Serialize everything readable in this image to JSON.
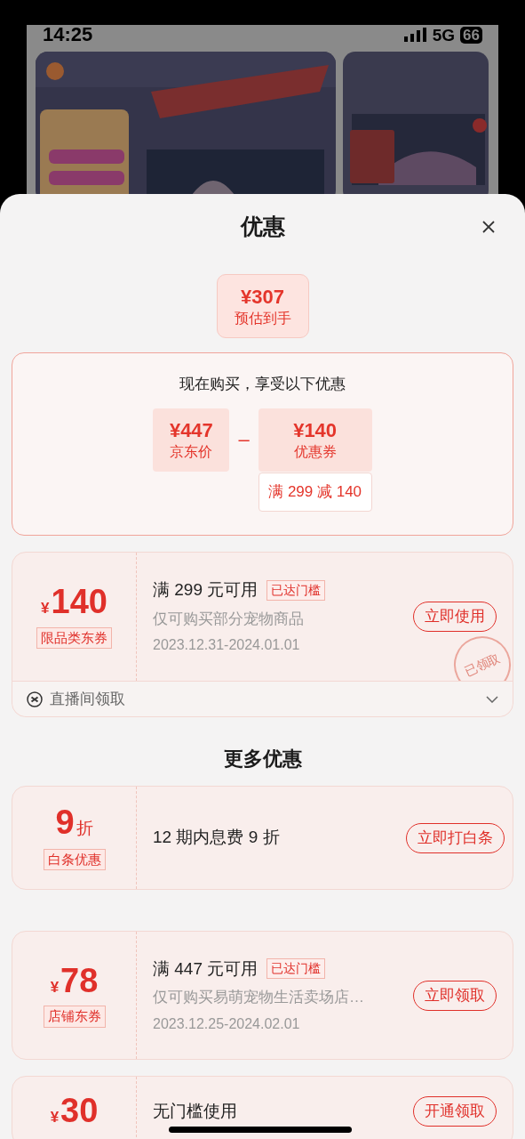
{
  "status_bar": {
    "time": "14:25",
    "network": "5G",
    "battery": "66"
  },
  "sheet": {
    "title": "优惠"
  },
  "estimate": {
    "amount": "¥307",
    "label": "预估到手"
  },
  "breakdown": {
    "heading": "现在购买，享受以下优惠",
    "operator": "–",
    "items": [
      {
        "amount": "¥447",
        "label": "京东价"
      },
      {
        "amount": "¥140",
        "label": "优惠券",
        "note": "满 299 减 140"
      }
    ]
  },
  "coupons": [
    {
      "kind": "amount",
      "currency": "¥",
      "value": "140",
      "tag": "限品类东券",
      "title": "满 299 元可用",
      "badge": "已达门槛",
      "desc": "仅可购买部分宠物商品",
      "dates": "2023.12.31-2024.01.01",
      "button": "立即使用",
      "stamp": "已领取",
      "source": "直播间领取"
    }
  ],
  "more_heading": "更多优惠",
  "more_coupons": [
    {
      "kind": "discount",
      "value": "9",
      "unit": "折",
      "tag": "白条优惠",
      "title": "12 期内息费 9 折",
      "button": "立即打白条"
    },
    {
      "kind": "amount",
      "currency": "¥",
      "value": "78",
      "tag": "店铺东券",
      "title": "满 447 元可用",
      "badge": "已达门槛",
      "desc": "仅可购买易萌宠物生活卖场店…",
      "dates": "2023.12.25-2024.02.01",
      "button": "立即领取"
    },
    {
      "kind": "amount",
      "currency": "¥",
      "value": "30",
      "title": "无门槛使用",
      "button": "开通领取"
    }
  ]
}
